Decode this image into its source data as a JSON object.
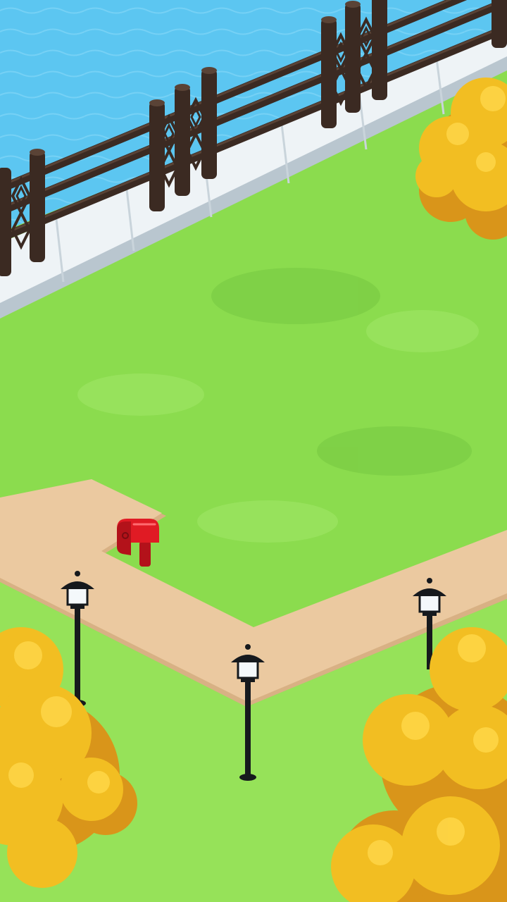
{
  "scene": {
    "type": "isometric-park-plot",
    "palette": {
      "water": "#5cc6f1",
      "water_light": "#8fdcfa",
      "stone_curb": "#eef3f6",
      "stone_shadow": "#b9c6cf",
      "fence": "#3b2a22",
      "fence_highlight": "#5a4336",
      "grass": "#8cdc4f",
      "grass_dark": "#74c63f",
      "grass_light": "#a4e86a",
      "path": "#ebc9a0",
      "path_edge": "#d8b184",
      "mailbox": "#e01b24",
      "lamp_post": "#16191d",
      "lamp_glass": "#f4f8fb",
      "tree_foliage": "#f2be22",
      "tree_highlight": "#ffd84a",
      "tree_shadow": "#d9951a"
    },
    "objects": [
      {
        "kind": "water",
        "icon": "water-icon"
      },
      {
        "kind": "fence",
        "icon": "fence-icon"
      },
      {
        "kind": "mailbox",
        "icon": "mailbox-icon"
      },
      {
        "kind": "street-lamp",
        "icon": "lamp-icon",
        "count": 3
      },
      {
        "kind": "tree",
        "icon": "tree-icon",
        "count": 3
      }
    ]
  }
}
